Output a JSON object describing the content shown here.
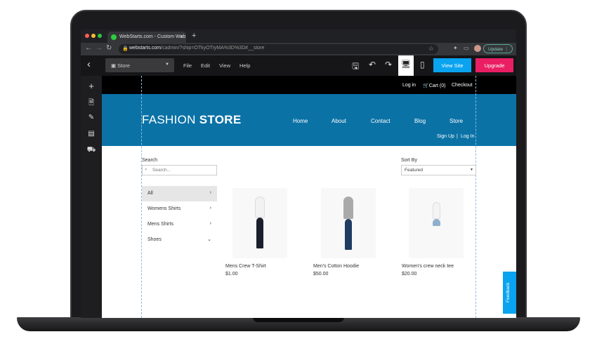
{
  "browser": {
    "tab_title": "WebStarts.com - Custom Web",
    "url_domain": "webstarts.com",
    "url_path": "/cadmin/?ship=OTkyOTIyMA%3D%3D#__store",
    "update_label": "Update"
  },
  "editor": {
    "page_select": "Store",
    "menu": [
      "File",
      "Edit",
      "View",
      "Help"
    ],
    "view_site": "View Site",
    "upgrade": "Upgrade"
  },
  "store": {
    "topnav": {
      "login": "Log in",
      "cart": "Cart (0)",
      "checkout": "Checkout"
    },
    "logo_light": "FASHION ",
    "logo_bold": "STORE",
    "nav": [
      "Home",
      "About",
      "Contact",
      "Blog",
      "Store"
    ],
    "signup": "Sign Up",
    "login": "Log In",
    "sep": "|",
    "search_label": "Search",
    "search_placeholder": "Search...",
    "sort_label": "Sort By",
    "sort_value": "Featured",
    "categories": [
      "All",
      "Womens Shirts",
      "Mens Shirts",
      "Shoes"
    ],
    "products": [
      {
        "name": "Mens Crew T-Shirt",
        "price": "$1.00"
      },
      {
        "name": "Men's Cotton Hoodie",
        "price": "$50.00"
      },
      {
        "name": "Women's crew neck tee",
        "price": "$20.00"
      }
    ],
    "feedback": "Feedback"
  },
  "colors": {
    "header": "#0b72a6",
    "view_site": "#09a3ef",
    "upgrade": "#ea1e63"
  }
}
